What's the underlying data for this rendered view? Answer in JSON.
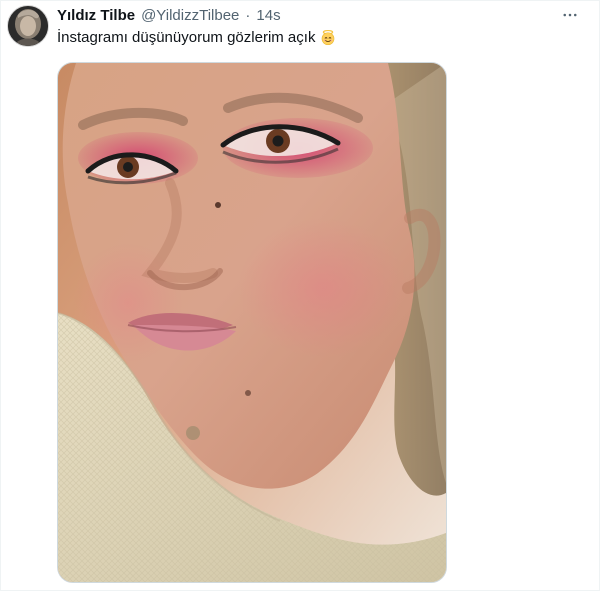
{
  "tweet": {
    "display_name": "Yıldız Tilbe",
    "handle": "@YildizzTilbee",
    "separator": "·",
    "time": "14s",
    "text": "İnstagramı düşünüyorum gözlerim açık",
    "emoji_icon": "angel-face-icon"
  },
  "colors": {
    "name": "#0f1419",
    "meta": "#536471",
    "border": "#eff3f4",
    "media_border": "#cfd9de"
  },
  "icons": {
    "more": "more-horizontal-icon",
    "avatar": "user-avatar"
  }
}
